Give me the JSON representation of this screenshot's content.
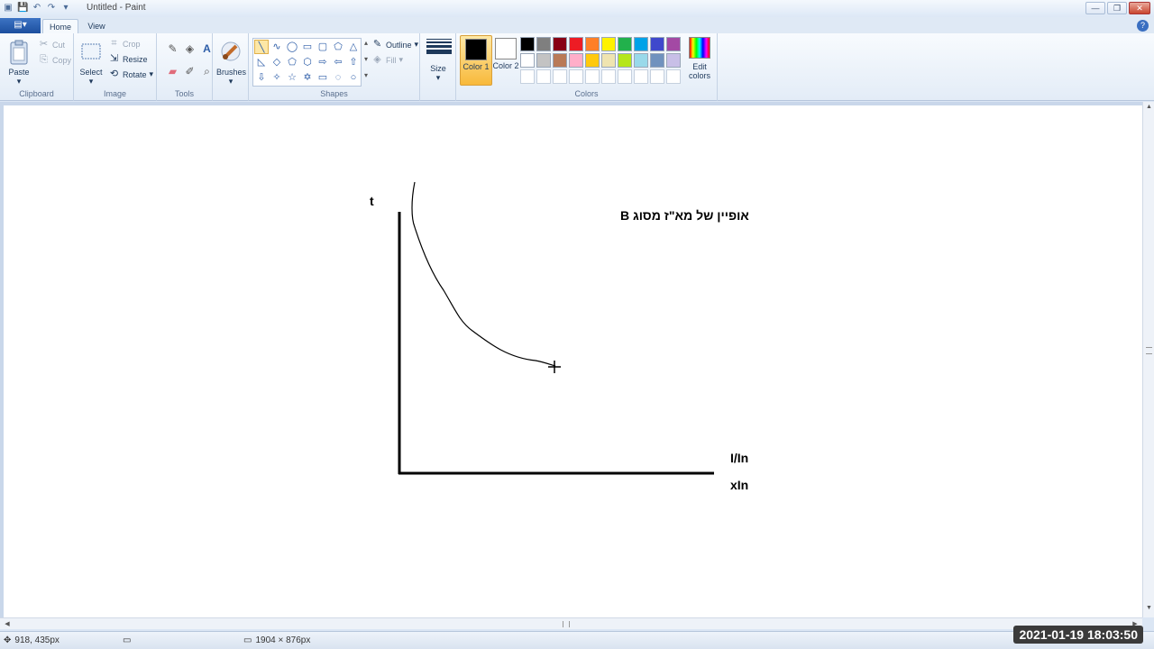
{
  "window": {
    "title": "Untitled - Paint"
  },
  "tabs": {
    "file_icon": "▤▾",
    "home": "Home",
    "view": "View"
  },
  "clipboard": {
    "paste": "Paste",
    "cut": "Cut",
    "copy": "Copy",
    "label": "Clipboard"
  },
  "image": {
    "select": "Select",
    "crop": "Crop",
    "resize": "Resize",
    "rotate": "Rotate",
    "label": "Image"
  },
  "tools": {
    "label": "Tools"
  },
  "brushes": {
    "label": "Brushes"
  },
  "shapes": {
    "outline": "Outline",
    "fill": "Fill",
    "label": "Shapes"
  },
  "size": {
    "label": "Size"
  },
  "colors": {
    "color1": "Color 1",
    "color2": "Color 2",
    "edit": "Edit colors",
    "label": "Colors",
    "palette": [
      "#000000",
      "#7f7f7f",
      "#880015",
      "#ed1c24",
      "#ff7f27",
      "#fff200",
      "#22b14c",
      "#00a2e8",
      "#3f48cc",
      "#a349a4",
      "#ffffff",
      "#c3c3c3",
      "#b97a57",
      "#ffaec9",
      "#ffc90e",
      "#efe4b0",
      "#b5e61d",
      "#99d9ea",
      "#7092be",
      "#c8bfe7",
      "#ffffff",
      "#ffffff",
      "#ffffff",
      "#ffffff",
      "#ffffff",
      "#ffffff",
      "#ffffff",
      "#ffffff",
      "#ffffff",
      "#ffffff"
    ]
  },
  "drawing": {
    "t_label": "t",
    "title": "B  אופיין של מא\"ז מסוג",
    "ln_label": "I/In",
    "xln_label": "xIn"
  },
  "status": {
    "cursor_pos": "918, 435px",
    "size": "1904 × 876px"
  },
  "timestamp": "2021-01-19  18:03:50"
}
